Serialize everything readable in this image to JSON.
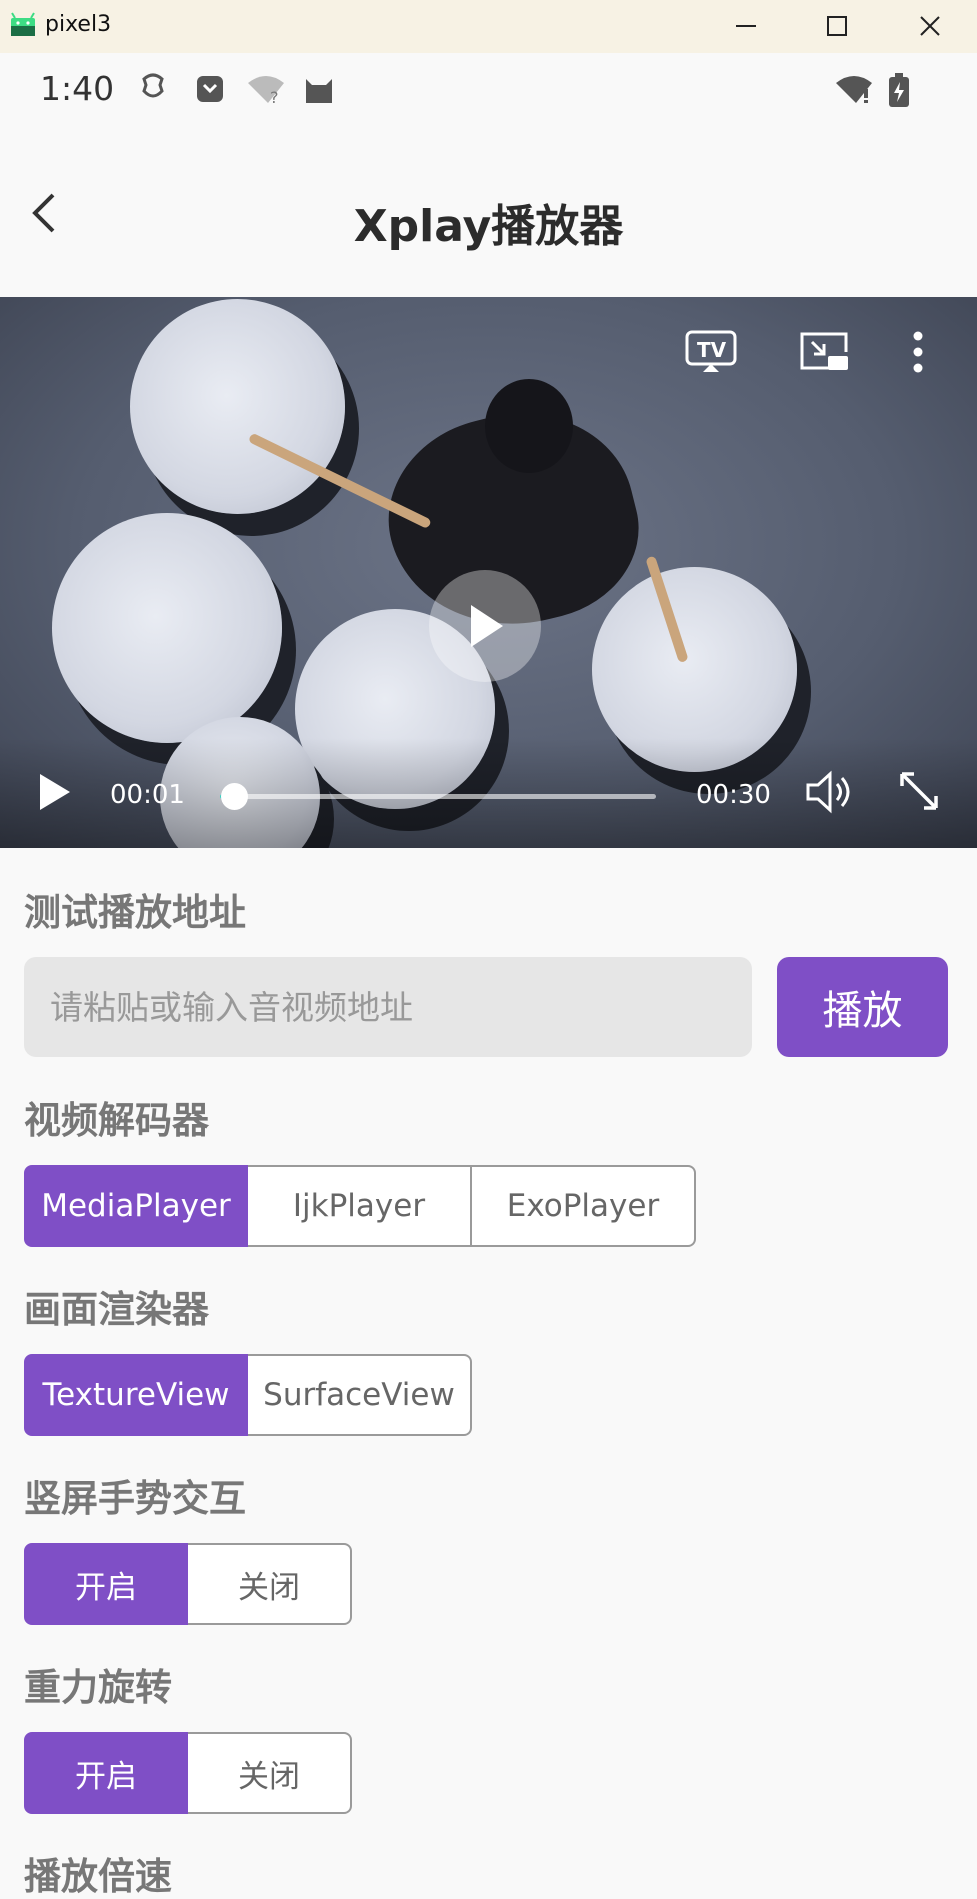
{
  "window": {
    "title": "pixel3"
  },
  "status": {
    "time": "1:40"
  },
  "header": {
    "title": "Xplay播放器"
  },
  "player": {
    "current_time": "00:01",
    "duration": "00:30",
    "progress": 0.033
  },
  "url_section": {
    "title": "测试播放地址",
    "placeholder": "请粘贴或输入音视频地址",
    "play_label": "播放"
  },
  "decoder": {
    "title": "视频解码器",
    "options": [
      "MediaPlayer",
      "IjkPlayer",
      "ExoPlayer"
    ],
    "selected": 0
  },
  "renderer": {
    "title": "画面渲染器",
    "options": [
      "TextureView",
      "SurfaceView"
    ],
    "selected": 0
  },
  "gesture": {
    "title": "竖屏手势交互",
    "options": [
      "开启",
      "关闭"
    ],
    "selected": 0
  },
  "gravity": {
    "title": "重力旋转",
    "options": [
      "开启",
      "关闭"
    ],
    "selected": 0
  },
  "speed": {
    "title": "播放倍速"
  },
  "colors": {
    "accent": "#7f4fc6",
    "progress": "#2fd0c0"
  }
}
